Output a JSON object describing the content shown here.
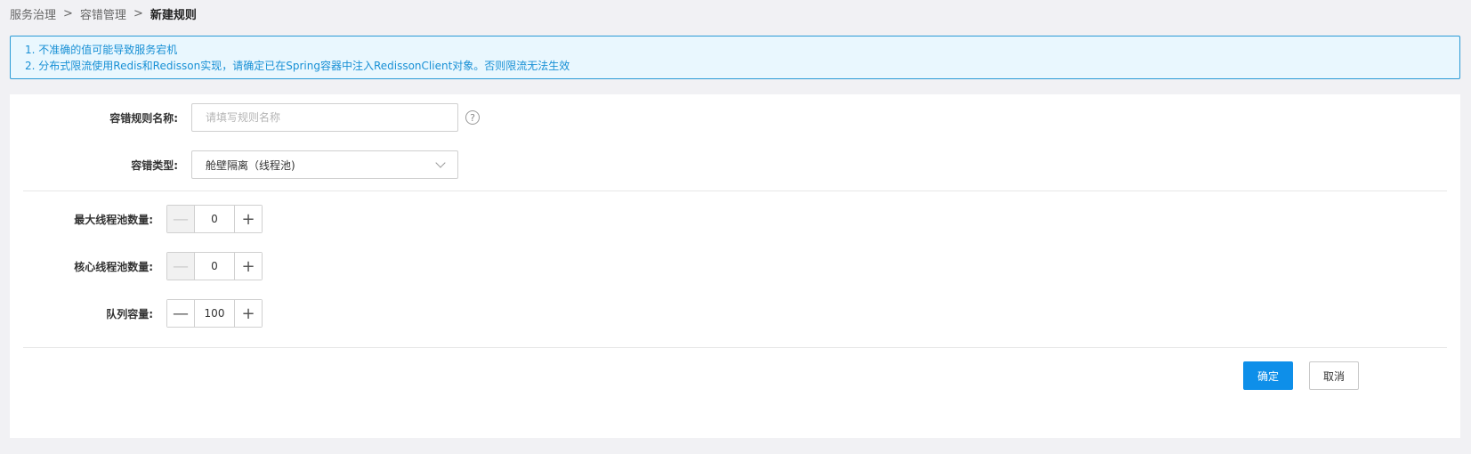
{
  "breadcrumb": {
    "items": [
      "服务治理",
      "容错管理"
    ],
    "separator": ">",
    "current": "新建规则"
  },
  "notice": {
    "line1": "1. 不准确的值可能导致服务宕机",
    "line2": "2. 分布式限流使用Redis和Redisson实现，请确定已在Spring容器中注入RedissonClient对象。否则限流无法生效"
  },
  "form": {
    "rule_name": {
      "label": "容错规则名称:",
      "placeholder": "请填写规则名称",
      "value": ""
    },
    "fault_type": {
      "label": "容错类型:",
      "selected": "舱壁隔离（线程池)"
    },
    "max_threads": {
      "label": "最大线程池数量:",
      "value": "0"
    },
    "core_threads": {
      "label": "核心线程池数量:",
      "value": "0"
    },
    "queue_capacity": {
      "label": "队列容量:",
      "value": "100"
    }
  },
  "actions": {
    "confirm": "确定",
    "cancel": "取消"
  },
  "icons": {
    "help": "question-circle-icon",
    "dropdown": "chevron-down-icon",
    "minus": "minus-icon",
    "plus": "plus-icon"
  },
  "colors": {
    "primary": "#0e8fe9",
    "notice_border": "#2a9bd6",
    "notice_bg": "#e9f7fe",
    "notice_text": "#1890d5"
  }
}
